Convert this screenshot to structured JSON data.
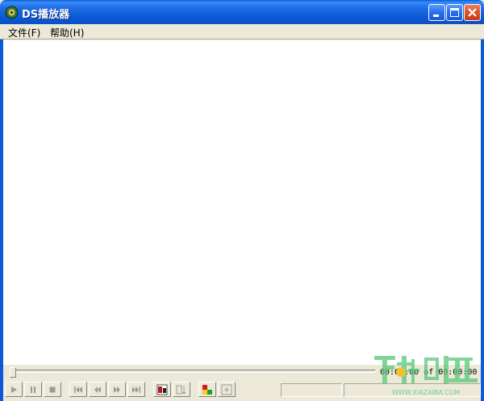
{
  "window": {
    "title": "DS播放器",
    "accent": "#0d5ad6",
    "close_color": "#d9542a"
  },
  "menu": {
    "items": [
      {
        "label": "文件(F)"
      },
      {
        "label": "帮助(H)"
      }
    ]
  },
  "player": {
    "time_display": "00:00:00 of 00:00:00",
    "progress": 0
  },
  "controls": [
    {
      "name": "play-button",
      "icon": "play-icon"
    },
    {
      "name": "pause-button",
      "icon": "pause-icon"
    },
    {
      "name": "stop-button",
      "icon": "stop-icon"
    },
    {
      "name": "previous-button",
      "icon": "skip-back-icon"
    },
    {
      "name": "rewind-button",
      "icon": "rewind-icon"
    },
    {
      "name": "fast-forward-button",
      "icon": "fast-forward-icon"
    },
    {
      "name": "next-button",
      "icon": "skip-forward-icon"
    },
    {
      "name": "subtitle-button",
      "icon": "subtitle-icon"
    },
    {
      "name": "sort-button",
      "icon": "sort-icon"
    },
    {
      "name": "open-button",
      "icon": "color-flag-icon"
    },
    {
      "name": "fullscreen-button",
      "icon": "fullscreen-icon"
    }
  ],
  "watermark": {
    "text": "下载吧",
    "sub": "WWW.XIAZAIBA.COM"
  }
}
